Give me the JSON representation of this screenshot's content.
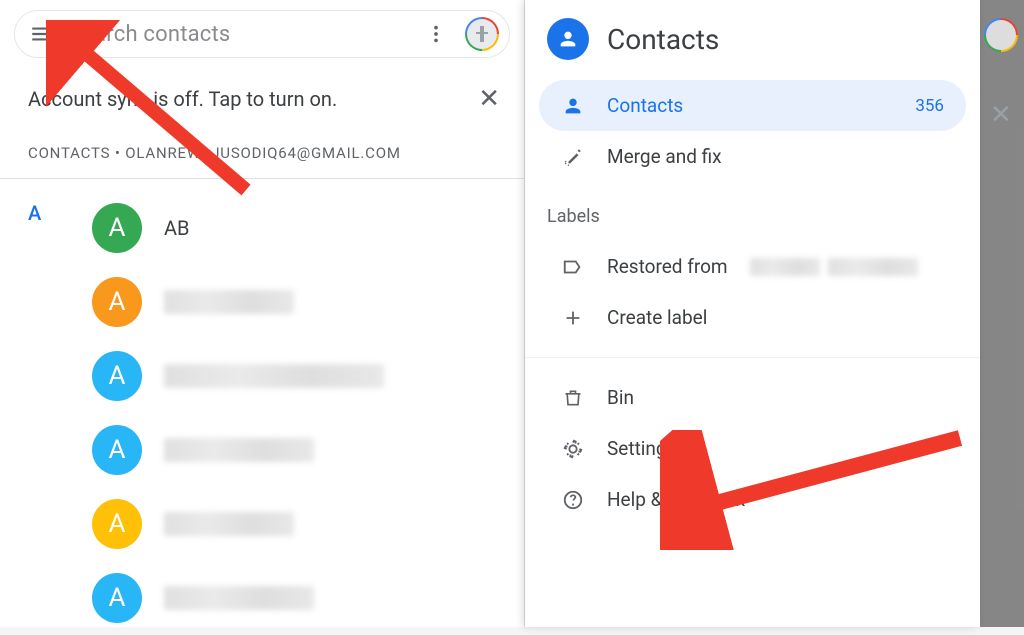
{
  "search": {
    "placeholder": "Search contacts"
  },
  "banner": {
    "sync_text": "Account sync is off. Tap to turn on.",
    "account_line": "CONTACTS • OLANREWAJUSODIQ64@GMAIL.COM"
  },
  "list": {
    "section_letter": "A",
    "items": [
      {
        "initial": "A",
        "name": "AB",
        "color": "green",
        "blurred": false
      },
      {
        "initial": "A",
        "name": "",
        "color": "orange",
        "blurred": true
      },
      {
        "initial": "A",
        "name": "",
        "color": "cyan",
        "blurred": true
      },
      {
        "initial": "A",
        "name": "",
        "color": "cyan",
        "blurred": true
      },
      {
        "initial": "A",
        "name": "",
        "color": "yellow",
        "blurred": true
      },
      {
        "initial": "A",
        "name": "",
        "color": "cyan",
        "blurred": true
      }
    ]
  },
  "drawer": {
    "title": "Contacts",
    "items": {
      "contacts": {
        "label": "Contacts",
        "count": "356"
      },
      "merge": {
        "label": "Merge and fix"
      },
      "labels_header": "Labels",
      "restored": {
        "label": "Restored from"
      },
      "create_label": {
        "label": "Create label"
      },
      "bin": {
        "label": "Bin"
      },
      "settings": {
        "label": "Settings"
      },
      "help": {
        "label": "Help & feedback"
      }
    }
  }
}
